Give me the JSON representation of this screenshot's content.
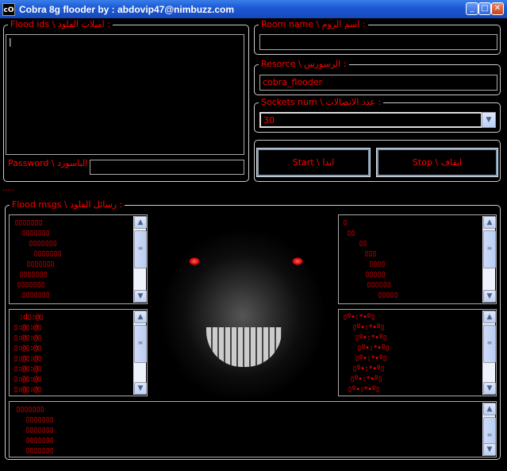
{
  "window": {
    "title": "Cobra 8g flooder by : abdovip47@nimbuzz.com",
    "icon_text": "cO",
    "minimize": "_",
    "maximize": "□",
    "close": "✕"
  },
  "flood_ids": {
    "label": "Flood ids \\ اميلات الفلود :",
    "value": "|"
  },
  "password": {
    "label": "Password \\ الباسورد :",
    "value": ""
  },
  "room": {
    "label": "Room name \\ اسم الروم :",
    "value": ""
  },
  "resource": {
    "label": "Resorce \\ الرسورس :",
    "value": "cobra_flooder"
  },
  "sockets": {
    "label": "Sockets num \\ عدد الاتصالات :",
    "value": "30"
  },
  "buttons": {
    "start": "Start \\ ابدا",
    "stop": "Stop \\ ايقاف"
  },
  "status": ".....",
  "flood_msgs": {
    "label": "Flood msgs \\ رسائل الفلود :",
    "box1": [
      "▯▯▯▯▯▯▯",
      "▯▯▯▯▯▯▯",
      "▯▯▯▯▯▯▯",
      "▯▯▯▯▯▯▯",
      "▯▯▯▯▯▯▯",
      "▯▯▯▯▯▯▯",
      "▯▯▯▯▯▯▯",
      "▯▯▯▯▯▯▯"
    ],
    "box2": [
      "▯",
      "▯▯",
      "▯▯",
      "▯▯▯",
      "▯▯▯▯",
      "▯▯▯▯▯",
      "▯▯▯▯▯▯",
      "▯▯▯▯▯"
    ],
    "box3": [
      ":d▯:@▯",
      "▯:@▯:@▯",
      "▯:@▯:@▯",
      "▯:@▯:@▯",
      "▯:@▯:@▯",
      "▯:@▯:@▯",
      "▯:@▯:@▯",
      "▯:@▯:@▯"
    ],
    "box4": [
      "▯º•:*•º▯",
      "▯º•:*•º▯",
      "▯º•:*•º▯",
      "▯º•:*•º▯",
      "▯º•:*•º▯",
      "▯º•:*•º▯",
      "▯º•:*•º▯",
      "▯º•:*•º▯"
    ],
    "box5": [
      "▯▯▯▯▯▯▯",
      "▯▯▯▯▯▯▯",
      "▯▯▯▯▯▯▯",
      "▯▯▯▯▯▯▯",
      "▯▯▯▯▯▯▯"
    ]
  },
  "colors": {
    "text": "#ff0000",
    "background": "#000000",
    "titlebar": "#1d5bd6"
  },
  "icons": {
    "scroll_up": "▲",
    "scroll_down": "▼",
    "dropdown": "▼"
  }
}
